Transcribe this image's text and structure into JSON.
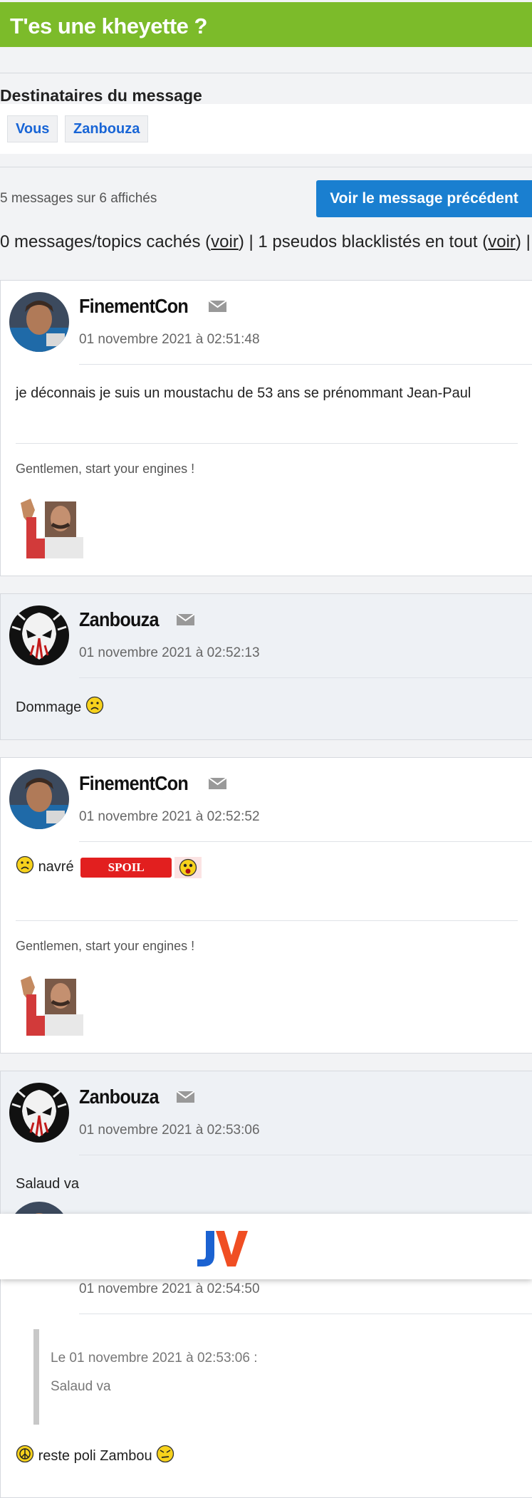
{
  "header": {
    "title": "T'es une kheyette ?"
  },
  "recipients": {
    "title": "Destinataires du message",
    "tags": [
      "Vous",
      "Zanbouza"
    ]
  },
  "pager": {
    "count": "5 messages sur 6 affichés",
    "prev_button": "Voir le message précédent"
  },
  "filter": {
    "part1": "0 messages/topics cachés (",
    "link1": "voir",
    "part2": ") | 1 pseudos blacklistés en tout (",
    "link2": "voir",
    "part3": ") |"
  },
  "messages": [
    {
      "author": "FinementCon",
      "date": "01 novembre 2021 à 02:51:48",
      "text": "je déconnais je suis un moustachu de 53 ans se prénommant Jean-Paul",
      "signature": "Gentlemen, start your engines !"
    },
    {
      "author": "Zanbouza",
      "date": "01 novembre 2021 à 02:52:13",
      "text": "Dommage"
    },
    {
      "author": "FinementCon",
      "date": "01 novembre 2021 à 02:52:52",
      "text": "navré",
      "spoil": "SPOIL",
      "signature": "Gentlemen, start your engines !"
    },
    {
      "author": "Zanbouza",
      "date": "01 novembre 2021 à 02:53:06",
      "text": "Salaud va"
    },
    {
      "date": "01 novembre 2021 à 02:54:50",
      "quote_head": "Le 01 novembre 2021 à 02:53:06 :",
      "quote_body": "Salaud va",
      "text": "reste poli Zambou"
    }
  ],
  "icons": {
    "mail": "envelope-icon",
    "logo": "jv-logo"
  },
  "colors": {
    "header_green": "#7cbb2a",
    "button_blue": "#1a7fd0",
    "tag_blue": "#1865d6",
    "spoil_red": "#e21f1f"
  }
}
